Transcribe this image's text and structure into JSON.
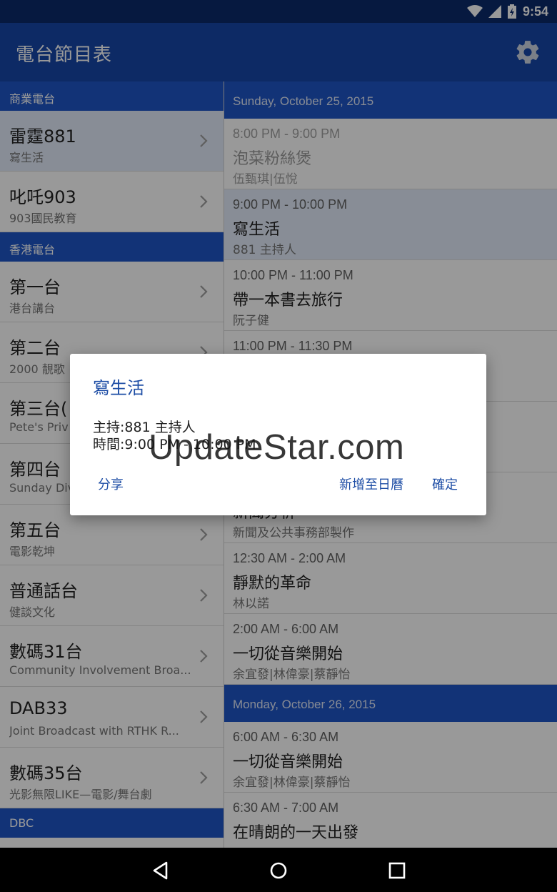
{
  "status_bar": {
    "time": "9:54"
  },
  "app_bar": {
    "title": "電台節目表"
  },
  "left_panel": {
    "sections": [
      {
        "header": "商業電台",
        "stations": [
          {
            "name": "雷霆881",
            "sub": "寫生活",
            "active": true
          },
          {
            "name": "叱吒903",
            "sub": "903國民教育"
          }
        ]
      },
      {
        "header": "香港電台",
        "stations": [
          {
            "name": "第一台",
            "sub": "港台講台"
          },
          {
            "name": "第二台",
            "sub": "2000 靚歌"
          },
          {
            "name": "第三台(",
            "sub": "Pete's Priv"
          },
          {
            "name": "第四台",
            "sub": "Sunday Div"
          },
          {
            "name": "第五台",
            "sub": "電影乾坤"
          },
          {
            "name": "普通話台",
            "sub": "健談文化"
          },
          {
            "name": "數碼31台",
            "sub": "Community Involvement Broa..."
          },
          {
            "name": "DAB33",
            "sub": "Joint Broadcast with RTHK R..."
          },
          {
            "name": "數碼35台",
            "sub": "光影無限LIKE—電影/舞台劇"
          }
        ]
      },
      {
        "header": "DBC",
        "stations": []
      }
    ]
  },
  "schedule": {
    "days": [
      {
        "date": "Sunday, October 25, 2015",
        "programs": [
          {
            "time": "8:00 PM - 9:00 PM",
            "title": "泡菜粉絲煲",
            "host": "伍甄琪|伍悅",
            "past": true
          },
          {
            "time": "9:00 PM - 10:00 PM",
            "title": "寫生活",
            "host": "881 主持人",
            "active": true
          },
          {
            "time": "10:00 PM - 11:00 PM",
            "title": "帶一本書去旅行",
            "host": "阮子健"
          },
          {
            "time": "11:00 PM - 11:30 PM",
            "title": "",
            "host": ""
          },
          {
            "time": "",
            "title": "",
            "host": ""
          },
          {
            "time": "",
            "title": "新聞分析",
            "host": "新聞及公共事務部製作"
          },
          {
            "time": "12:30 AM - 2:00 AM",
            "title": "靜默的革命",
            "host": "林以諾"
          },
          {
            "time": "2:00 AM - 6:00 AM",
            "title": "一切從音樂開始",
            "host": "余宜發|林偉豪|蔡靜怡"
          }
        ]
      },
      {
        "date": "Monday, October 26, 2015",
        "programs": [
          {
            "time": "6:00 AM - 6:30 AM",
            "title": "一切從音樂開始",
            "host": "余宜發|林偉豪|蔡靜怡"
          },
          {
            "time": "6:30 AM - 7:00 AM",
            "title": "在晴朗的一天出發",
            "host": ""
          }
        ]
      }
    ]
  },
  "dialog": {
    "title": "寫生活",
    "host_line": "主持:881 主持人",
    "time_line": "時間:9:00 PM - 10:00 PM",
    "share_label": "分享",
    "add_calendar_label": "新增至日曆",
    "ok_label": "確定"
  },
  "watermark": "UpdateStar.com",
  "colors": {
    "app_bar": "#1647a8",
    "section_header": "#1f56c6",
    "status_bar": "#0a2a6b",
    "dialog_accent": "#1d4da5"
  }
}
